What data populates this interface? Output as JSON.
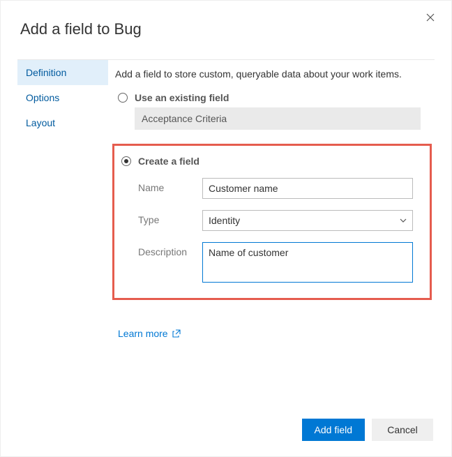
{
  "dialog": {
    "title": "Add a field to Bug",
    "close_label": "Close"
  },
  "sidebar": {
    "items": [
      {
        "label": "Definition",
        "active": true
      },
      {
        "label": "Options",
        "active": false
      },
      {
        "label": "Layout",
        "active": false
      }
    ]
  },
  "main": {
    "intro": "Add a field to store custom, queryable data about your work items.",
    "existing": {
      "label": "Use an existing field",
      "selected_value": "Acceptance Criteria",
      "checked": false
    },
    "create": {
      "label": "Create a field",
      "checked": true,
      "name_label": "Name",
      "name_value": "Customer name",
      "type_label": "Type",
      "type_value": "Identity",
      "description_label": "Description",
      "description_value": "Name of customer"
    },
    "learn_more": "Learn more"
  },
  "footer": {
    "primary": "Add field",
    "secondary": "Cancel"
  }
}
